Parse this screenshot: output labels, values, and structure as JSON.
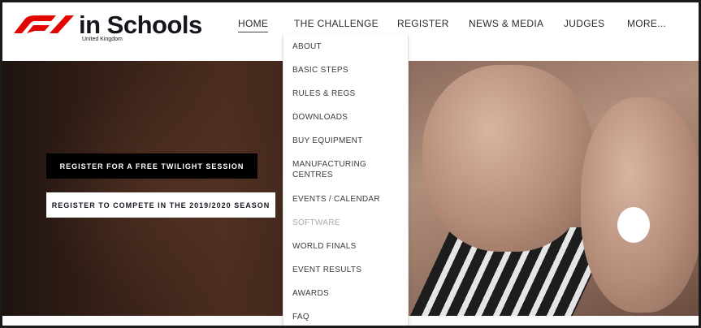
{
  "brand": {
    "title": "in Schools",
    "subtitle": "United Kingdom",
    "logo_colors": {
      "red": "#e10600",
      "dark": "#15151e"
    }
  },
  "nav": {
    "items": [
      "HOME",
      "THE CHALLENGE",
      "REGISTER",
      "NEWS & MEDIA",
      "JUDGES",
      "MORE..."
    ],
    "active": "HOME"
  },
  "dropdown": {
    "parent": "THE CHALLENGE",
    "items": [
      "ABOUT",
      "BASIC STEPS",
      "RULES & REGS",
      "DOWNLOADS",
      "BUY EQUIPMENT",
      "MANUFACTURING",
      "CENTRES",
      "EVENTS / CALENDAR",
      "SOFTWARE",
      "WORLD FINALS",
      "EVENT RESULTS",
      "AWARDS",
      "FAQ"
    ],
    "muted_item": "SOFTWARE"
  },
  "hero": {
    "cta_primary": "REGISTER FOR A FREE TWILIGHT SESSION",
    "cta_secondary": "REGISTER TO COMPETE IN THE 2019/2020 SEASON"
  },
  "colors": {
    "accent": "#e10600",
    "text_dark": "#15151e",
    "cta_primary_bg": "#000000",
    "cta_secondary_bg": "#ffffff"
  }
}
